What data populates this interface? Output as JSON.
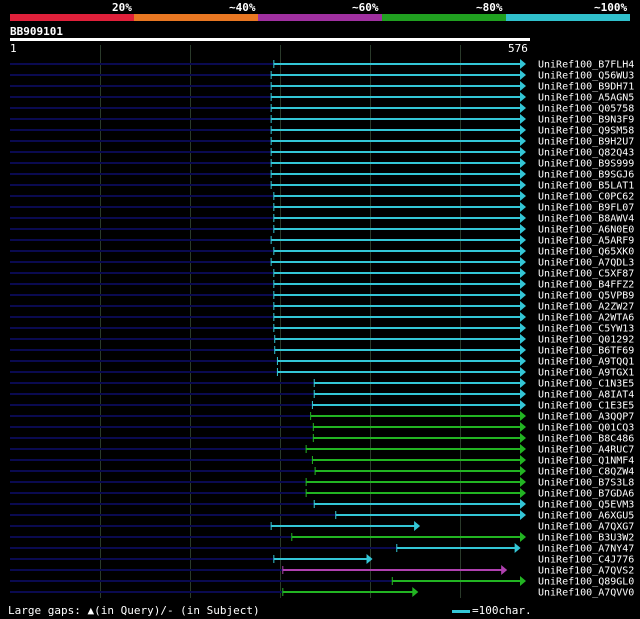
{
  "legend": {
    "labels": [
      "20%",
      "~40%",
      "~60%",
      "~80%",
      "~100%"
    ],
    "bands": [
      "#e0203a",
      "#e87722",
      "#a030a0",
      "#20a020",
      "#30c0cc"
    ]
  },
  "query": {
    "id": "BB909101",
    "start": "1",
    "end": "576"
  },
  "colors": {
    "cyan": "#33c6d6",
    "green": "#22b422",
    "magenta": "#b040b0",
    "navy": "#0a0a50"
  },
  "hits": [
    {
      "label": "UniRef100_B7FLH4",
      "color": "cyan",
      "start": 295,
      "end": 576
    },
    {
      "label": "UniRef100_Q56WU3",
      "color": "cyan",
      "start": 292,
      "end": 576
    },
    {
      "label": "UniRef100_B9DH71",
      "color": "cyan",
      "start": 292,
      "end": 576
    },
    {
      "label": "UniRef100_A5AGN5",
      "color": "cyan",
      "start": 292,
      "end": 576
    },
    {
      "label": "UniRef100_Q05758",
      "color": "cyan",
      "start": 292,
      "end": 576
    },
    {
      "label": "UniRef100_B9N3F9",
      "color": "cyan",
      "start": 292,
      "end": 576
    },
    {
      "label": "UniRef100_Q9SM58",
      "color": "cyan",
      "start": 292,
      "end": 576
    },
    {
      "label": "UniRef100_B9H2U7",
      "color": "cyan",
      "start": 292,
      "end": 576
    },
    {
      "label": "UniRef100_Q82Q43",
      "color": "cyan",
      "start": 292,
      "end": 576
    },
    {
      "label": "UniRef100_B9S999",
      "color": "cyan",
      "start": 292,
      "end": 576
    },
    {
      "label": "UniRef100_B9SGJ6",
      "color": "cyan",
      "start": 292,
      "end": 576
    },
    {
      "label": "UniRef100_B5LAT1",
      "color": "cyan",
      "start": 292,
      "end": 576
    },
    {
      "label": "UniRef100_C0PC62",
      "color": "cyan",
      "start": 295,
      "end": 576
    },
    {
      "label": "UniRef100_B9FL07",
      "color": "cyan",
      "start": 295,
      "end": 576
    },
    {
      "label": "UniRef100_B8AWV4",
      "color": "cyan",
      "start": 295,
      "end": 576
    },
    {
      "label": "UniRef100_A6N0E0",
      "color": "cyan",
      "start": 295,
      "end": 576
    },
    {
      "label": "UniRef100_A5ARF9",
      "color": "cyan",
      "start": 292,
      "end": 576
    },
    {
      "label": "UniRef100_Q65XK0",
      "color": "cyan",
      "start": 295,
      "end": 576
    },
    {
      "label": "UniRef100_A7QDL3",
      "color": "cyan",
      "start": 292,
      "end": 576
    },
    {
      "label": "UniRef100_C5XF87",
      "color": "cyan",
      "start": 295,
      "end": 576
    },
    {
      "label": "UniRef100_B4FFZ2",
      "color": "cyan",
      "start": 295,
      "end": 576
    },
    {
      "label": "UniRef100_Q5VPB9",
      "color": "cyan",
      "start": 295,
      "end": 576
    },
    {
      "label": "UniRef100_A2ZW27",
      "color": "cyan",
      "start": 295,
      "end": 576
    },
    {
      "label": "UniRef100_A2WTA6",
      "color": "cyan",
      "start": 295,
      "end": 576
    },
    {
      "label": "UniRef100_C5YW13",
      "color": "cyan",
      "start": 295,
      "end": 576
    },
    {
      "label": "UniRef100_Q01292",
      "color": "cyan",
      "start": 296,
      "end": 576
    },
    {
      "label": "UniRef100_B6TF69",
      "color": "cyan",
      "start": 296,
      "end": 576
    },
    {
      "label": "UniRef100_A9TQQ1",
      "color": "cyan",
      "start": 299,
      "end": 576
    },
    {
      "label": "UniRef100_A9TGX1",
      "color": "cyan",
      "start": 299,
      "end": 576
    },
    {
      "label": "UniRef100_C1N3E5",
      "color": "cyan",
      "start": 340,
      "end": 576
    },
    {
      "label": "UniRef100_A8IAT4",
      "color": "cyan",
      "start": 340,
      "end": 576
    },
    {
      "label": "UniRef100_C1E3E5",
      "color": "cyan",
      "start": 338,
      "end": 576
    },
    {
      "label": "UniRef100_A3QQP7",
      "color": "green",
      "start": 336,
      "end": 576
    },
    {
      "label": "UniRef100_Q01CQ3",
      "color": "green",
      "start": 339,
      "end": 576
    },
    {
      "label": "UniRef100_B8C486",
      "color": "green",
      "start": 339,
      "end": 576
    },
    {
      "label": "UniRef100_A4RUC7",
      "color": "green",
      "start": 331,
      "end": 576
    },
    {
      "label": "UniRef100_Q1NMF4",
      "color": "green",
      "start": 338,
      "end": 576
    },
    {
      "label": "UniRef100_C8QZW4",
      "color": "green",
      "start": 341,
      "end": 576
    },
    {
      "label": "UniRef100_B7S3L8",
      "color": "green",
      "start": 331,
      "end": 576
    },
    {
      "label": "UniRef100_B7GDA6",
      "color": "green",
      "start": 331,
      "end": 576
    },
    {
      "label": "UniRef100_Q5EVM3",
      "color": "cyan",
      "start": 340,
      "end": 576
    },
    {
      "label": "UniRef100_A6XGU5",
      "color": "cyan",
      "start": 364,
      "end": 576
    },
    {
      "label": "UniRef100_A7QXG7",
      "color": "cyan",
      "start": 292,
      "end": 458
    },
    {
      "label": "UniRef100_B3U3W2",
      "color": "green",
      "start": 315,
      "end": 576
    },
    {
      "label": "UniRef100_A7NY47",
      "color": "cyan",
      "start": 432,
      "end": 570
    },
    {
      "label": "UniRef100_C4J776",
      "color": "cyan",
      "start": 295,
      "end": 405
    },
    {
      "label": "UniRef100_A7QVS2",
      "color": "magenta",
      "start": 305,
      "end": 555
    },
    {
      "label": "UniRef100_Q89GL0",
      "color": "green",
      "start": 427,
      "end": 576
    },
    {
      "label": "UniRef100_A7QVV0",
      "color": "green",
      "start": 305,
      "end": 456
    }
  ],
  "footer": {
    "gaps_text": "Large gaps: ▲(in Query)/- (in Subject)",
    "scale_text": "=100char."
  }
}
